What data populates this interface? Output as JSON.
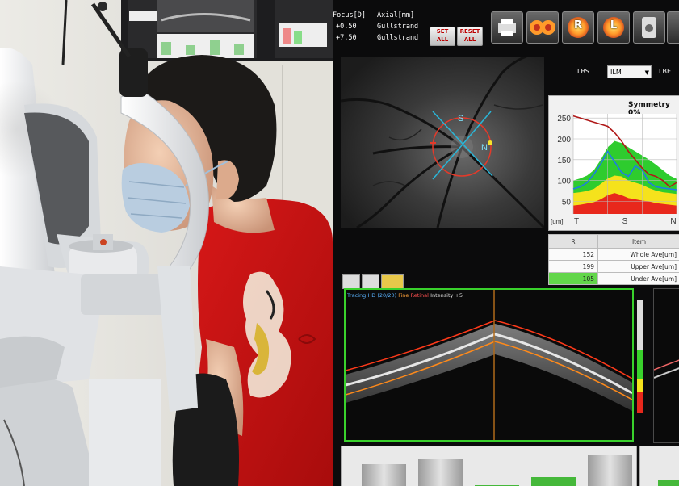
{
  "screen": {
    "focus_header": "Focus[D]",
    "axial_header": "Axial[mm]",
    "focus_values": [
      "+0.50",
      "+7.50"
    ],
    "axial_values": [
      "Gullstrand",
      "Gullstrand"
    ],
    "small_buttons": [
      "SET ALL",
      "RESET ALL"
    ],
    "letter_buttons": [
      "R",
      "L"
    ],
    "lbs_label": "LBS",
    "lbe_label": "LBE",
    "layer_select": "ILM",
    "fundus_labels": {
      "superior": "S",
      "nasal": "N"
    },
    "symmetry_title": "Symmetry 0%",
    "thickness_unit": "[um]",
    "thickness_sectors": [
      "T",
      "S",
      "N"
    ],
    "table": {
      "headers": [
        "R",
        "Item"
      ],
      "rows": [
        {
          "value": "152",
          "item": "Whole Ave[um]"
        },
        {
          "value": "199",
          "item": "Upper Ave[um]"
        },
        {
          "value": "105",
          "item": "Under Ave[um]"
        }
      ]
    },
    "bscan_header": [
      "Tracing HD (20/20)",
      "Fine",
      "Retinal",
      "Intensity +5"
    ],
    "colors": {
      "ilm_line": "#ff3a1a",
      "rpe_line": "#ff8a1a",
      "frame_green": "#39d12c",
      "blue_curve": "#1e7be6",
      "red_curve": "#b01818"
    }
  },
  "chart_data": {
    "type": "area",
    "title": "Symmetry 0%",
    "xlabel": "",
    "ylabel": "[um]",
    "x_ticks": [
      "T",
      "S",
      "N"
    ],
    "y_ticks": [
      50,
      100,
      150,
      200,
      250
    ],
    "ylim": [
      20,
      260
    ],
    "bands": [
      {
        "color": "#2ecc2e",
        "lower": 0,
        "upper": [
          100,
          105,
          112,
          125,
          150,
          180,
          195,
          190,
          180,
          170,
          160,
          150,
          138,
          125,
          112,
          104
        ]
      },
      {
        "color": "#f5e21c",
        "lower": 0,
        "upper": [
          70,
          72,
          75,
          80,
          92,
          105,
          112,
          110,
          100,
          95,
          90,
          82,
          76,
          72,
          70,
          68
        ]
      },
      {
        "color": "#e8281c",
        "lower": 0,
        "upper": [
          40,
          42,
          45,
          48,
          55,
          65,
          70,
          65,
          58,
          55,
          52,
          50,
          46,
          44,
          42,
          40
        ]
      }
    ],
    "series": [
      {
        "color": "#1e7be6",
        "values": [
          80,
          85,
          95,
          115,
          140,
          170,
          145,
          120,
          110,
          135,
          125,
          95,
          85,
          82,
          80,
          78
        ]
      },
      {
        "color": "#b01818",
        "values": [
          255,
          250,
          245,
          240,
          235,
          230,
          215,
          195,
          170,
          150,
          130,
          115,
          110,
          100,
          85,
          95
        ]
      }
    ]
  }
}
